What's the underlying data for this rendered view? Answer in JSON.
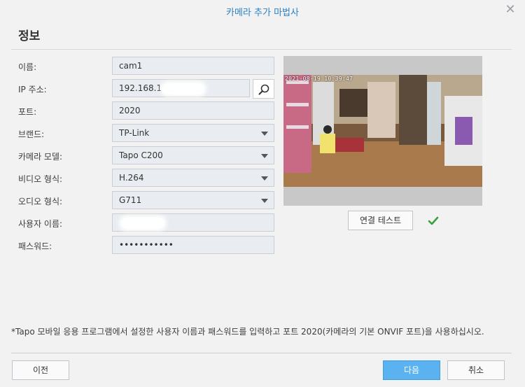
{
  "dialog": {
    "title": "카메라 추가 마법사",
    "close_symbol": "✕",
    "section_title": "정보"
  },
  "form": {
    "name": {
      "label": "이름:",
      "value": "cam1"
    },
    "ip": {
      "label": "IP 주소:",
      "value": "192.168.1"
    },
    "port": {
      "label": "포트:",
      "value": "2020"
    },
    "brand": {
      "label": "브랜드:",
      "value": "TP-Link"
    },
    "model": {
      "label": "카메라 모델:",
      "value": "Tapo C200"
    },
    "video": {
      "label": "비디오 형식:",
      "value": "H.264"
    },
    "audio": {
      "label": "오디오 형식:",
      "value": "G711"
    },
    "username": {
      "label": "사용자 이름:",
      "value": ""
    },
    "password": {
      "label": "패스워드:",
      "value": "•••••••••••"
    }
  },
  "preview": {
    "timestamp": "2021-08-19 10:39:47"
  },
  "test_connection": {
    "label": "연결 테스트",
    "status_icon": "check-icon",
    "status_color": "#3aa03a"
  },
  "note": "*Tapo 모바일 응용 프로그램에서 설정한 사용자 이름과 패스워드를 입력하고 포트 2020(카메라의 기본 ONVIF 포트)을 사용하십시오.",
  "footer": {
    "prev_label": "이전",
    "next_label": "다음",
    "cancel_label": "취소"
  },
  "colors": {
    "title": "#2b7fc3",
    "primary_button": "#5ab3f0",
    "field_background": "#e9edf1"
  }
}
